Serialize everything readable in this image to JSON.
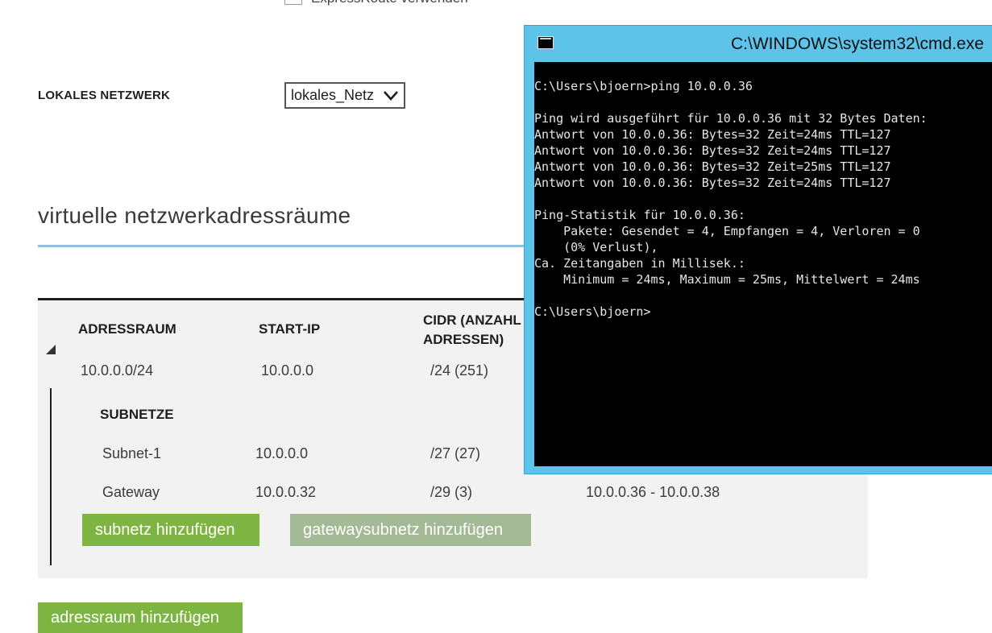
{
  "top": {
    "express_label": "ExpressRoute verwenden"
  },
  "local_network": {
    "label": "LOKALES NETZWERK",
    "selected": "lokales_Netz"
  },
  "section": {
    "title": "virtuelle netzwerkadressräume"
  },
  "table": {
    "columns": [
      "ADRESSRAUM",
      "START-IP",
      "CIDR (ANZAHL\nADRESSEN)"
    ],
    "address_space": {
      "range": "10.0.0.0/24",
      "start_ip": "10.0.0.0",
      "cidr": "/24 (251)"
    },
    "subnets_label": "SUBNETZE",
    "subnets": [
      {
        "name": "Subnet-1",
        "start_ip": "10.0.0.0",
        "cidr": "/27 (27)",
        "usable": ""
      },
      {
        "name": "Gateway",
        "start_ip": "10.0.0.32",
        "cidr": "/29 (3)",
        "usable": "10.0.0.36 - 10.0.0.38"
      }
    ]
  },
  "buttons": {
    "add_subnet": "subnetz hinzufügen",
    "add_gateway_subnet": "gatewaysubnetz hinzufügen",
    "add_address_space": "adressraum hinzufügen"
  },
  "cmd": {
    "title": "C:\\WINDOWS\\system32\\cmd.exe",
    "output": "C:\\Users\\bjoern>ping 10.0.0.36\n\nPing wird ausgeführt für 10.0.0.36 mit 32 Bytes Daten:\nAntwort von 10.0.0.36: Bytes=32 Zeit=24ms TTL=127\nAntwort von 10.0.0.36: Bytes=32 Zeit=24ms TTL=127\nAntwort von 10.0.0.36: Bytes=32 Zeit=25ms TTL=127\nAntwort von 10.0.0.36: Bytes=32 Zeit=24ms TTL=127\n\nPing-Statistik für 10.0.0.36:\n    Pakete: Gesendet = 4, Empfangen = 4, Verloren = 0\n    (0% Verlust),\nCa. Zeitangaben in Millisek.:\n    Minimum = 24ms, Maximum = 25ms, Mittelwert = 24ms\n\nC:\\Users\\bjoern>"
  },
  "colors": {
    "accent_green": "#7eb441",
    "muted_green": "#a4b996",
    "cmd_frame": "#5ec3e9",
    "rule_blue": "#8fc1e3"
  }
}
